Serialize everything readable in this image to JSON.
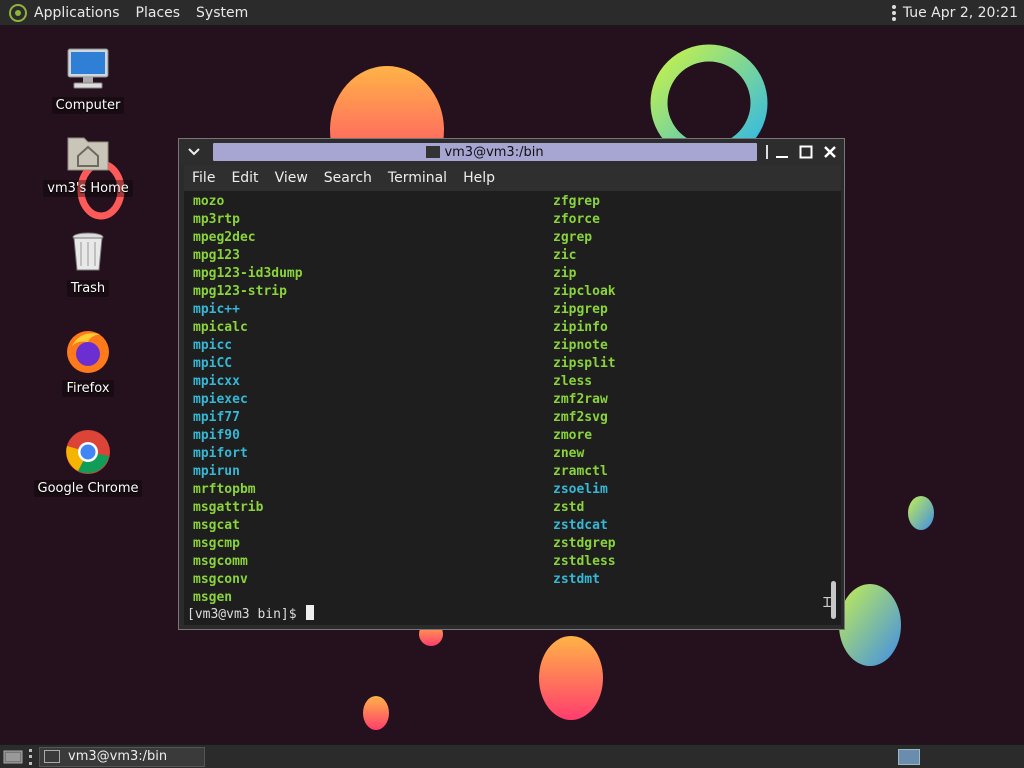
{
  "top_panel": {
    "menus": [
      "Applications",
      "Places",
      "System"
    ],
    "clock": "Tue Apr  2, 20:21"
  },
  "desktop": {
    "icons": [
      {
        "label": "Computer",
        "icon": "computer-icon"
      },
      {
        "label": "vm3's Home",
        "icon": "home-folder-icon"
      },
      {
        "label": "Trash",
        "icon": "trash-icon"
      },
      {
        "label": "Firefox",
        "icon": "firefox-icon"
      },
      {
        "label": "Google Chrome",
        "icon": "chrome-icon"
      }
    ]
  },
  "terminal": {
    "title": "vm3@vm3:/bin",
    "menus": [
      "File",
      "Edit",
      "View",
      "Search",
      "Terminal",
      "Help"
    ],
    "left_entries": [
      {
        "text": "mozo",
        "color": "green"
      },
      {
        "text": "mp3rtp",
        "color": "green"
      },
      {
        "text": "mpeg2dec",
        "color": "green"
      },
      {
        "text": "mpg123",
        "color": "green"
      },
      {
        "text": "mpg123-id3dump",
        "color": "green"
      },
      {
        "text": "mpg123-strip",
        "color": "green"
      },
      {
        "text": "mpic++",
        "color": "cyan"
      },
      {
        "text": "mpicalc",
        "color": "green"
      },
      {
        "text": "mpicc",
        "color": "cyan"
      },
      {
        "text": "mpiCC",
        "color": "cyan"
      },
      {
        "text": "mpicxx",
        "color": "cyan"
      },
      {
        "text": "mpiexec",
        "color": "cyan"
      },
      {
        "text": "mpif77",
        "color": "cyan"
      },
      {
        "text": "mpif90",
        "color": "cyan"
      },
      {
        "text": "mpifort",
        "color": "cyan"
      },
      {
        "text": "mpirun",
        "color": "cyan"
      },
      {
        "text": "mrftopbm",
        "color": "green"
      },
      {
        "text": "msgattrib",
        "color": "green"
      },
      {
        "text": "msgcat",
        "color": "green"
      },
      {
        "text": "msgcmp",
        "color": "green"
      },
      {
        "text": "msgcomm",
        "color": "green"
      },
      {
        "text": "msgconv",
        "color": "green"
      },
      {
        "text": "msgen",
        "color": "green"
      }
    ],
    "right_entries": [
      {
        "text": "zfgrep",
        "color": "green"
      },
      {
        "text": "zforce",
        "color": "green"
      },
      {
        "text": "zgrep",
        "color": "green"
      },
      {
        "text": "zic",
        "color": "green"
      },
      {
        "text": "zip",
        "color": "green"
      },
      {
        "text": "zipcloak",
        "color": "green"
      },
      {
        "text": "zipgrep",
        "color": "green"
      },
      {
        "text": "zipinfo",
        "color": "green"
      },
      {
        "text": "zipnote",
        "color": "green"
      },
      {
        "text": "zipsplit",
        "color": "green"
      },
      {
        "text": "zless",
        "color": "green"
      },
      {
        "text": "zmf2raw",
        "color": "green"
      },
      {
        "text": "zmf2svg",
        "color": "green"
      },
      {
        "text": "zmore",
        "color": "green"
      },
      {
        "text": "znew",
        "color": "green"
      },
      {
        "text": "zramctl",
        "color": "green"
      },
      {
        "text": "zsoelim",
        "color": "cyan"
      },
      {
        "text": "zstd",
        "color": "green"
      },
      {
        "text": "zstdcat",
        "color": "cyan"
      },
      {
        "text": "zstdgrep",
        "color": "green"
      },
      {
        "text": "zstdless",
        "color": "green"
      },
      {
        "text": "zstdmt",
        "color": "cyan"
      }
    ],
    "prompt": "[vm3@vm3 bin]$ "
  },
  "taskbar": {
    "task_label": "vm3@vm3:/bin"
  },
  "colors": {
    "green": "#8ad33b",
    "cyan": "#35b7d5",
    "title_strip": "#a7a5d1"
  }
}
